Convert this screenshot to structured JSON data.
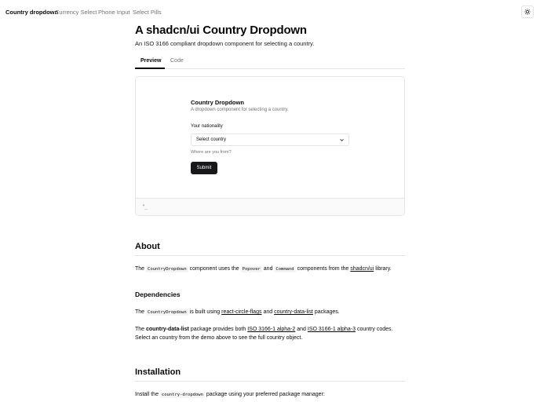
{
  "nav": {
    "brand": "Country dropdown",
    "links": [
      "Currency Select",
      "Phone Input",
      "Select Pills"
    ]
  },
  "header": {
    "title": "A shadcn/ui Country Dropdown",
    "subtitle": "An ISO 3166 compliant dropdown component for selecting a country."
  },
  "tabs": [
    {
      "label": "Preview",
      "active": true
    },
    {
      "label": "Code",
      "active": false
    }
  ],
  "preview": {
    "form_title": "Country Dropdown",
    "form_description": "A dropdown component for selecting a country.",
    "field_label": "Your nationality",
    "select_value": "Select country",
    "field_hint": "Where are you from?",
    "submit_label": "Submit",
    "footer_text": "\"_"
  },
  "about": {
    "heading": "About",
    "p1": {
      "t1": "The",
      "c1": "CountryDropdown",
      "t2": "component uses the",
      "c2": "Popover",
      "t3": "and",
      "c3": "Command",
      "t4": "components from the",
      "link": "shadcn/ui",
      "t5": "library."
    },
    "deps_heading": "Dependencies",
    "p2": {
      "t1": "The",
      "c1": "CountryDropdown",
      "t2": "is built using",
      "link1": "react-circle-flags",
      "t3": "and",
      "link2": "country-data-list",
      "t4": "packages."
    },
    "p3": {
      "b1": "country-data-list",
      "t1": "package provides both",
      "link1": "ISO 3166-1 alpha-2",
      "t2": "and",
      "link2": "ISO 3166-1 alpha-3",
      "t3": "country codes. Select an country from the demo above to see the full country object."
    }
  },
  "installation": {
    "heading": "Installation",
    "p1": {
      "t1": "Install the",
      "c1": "country-dropdown",
      "t2": "package using your preferred package manager:"
    }
  }
}
